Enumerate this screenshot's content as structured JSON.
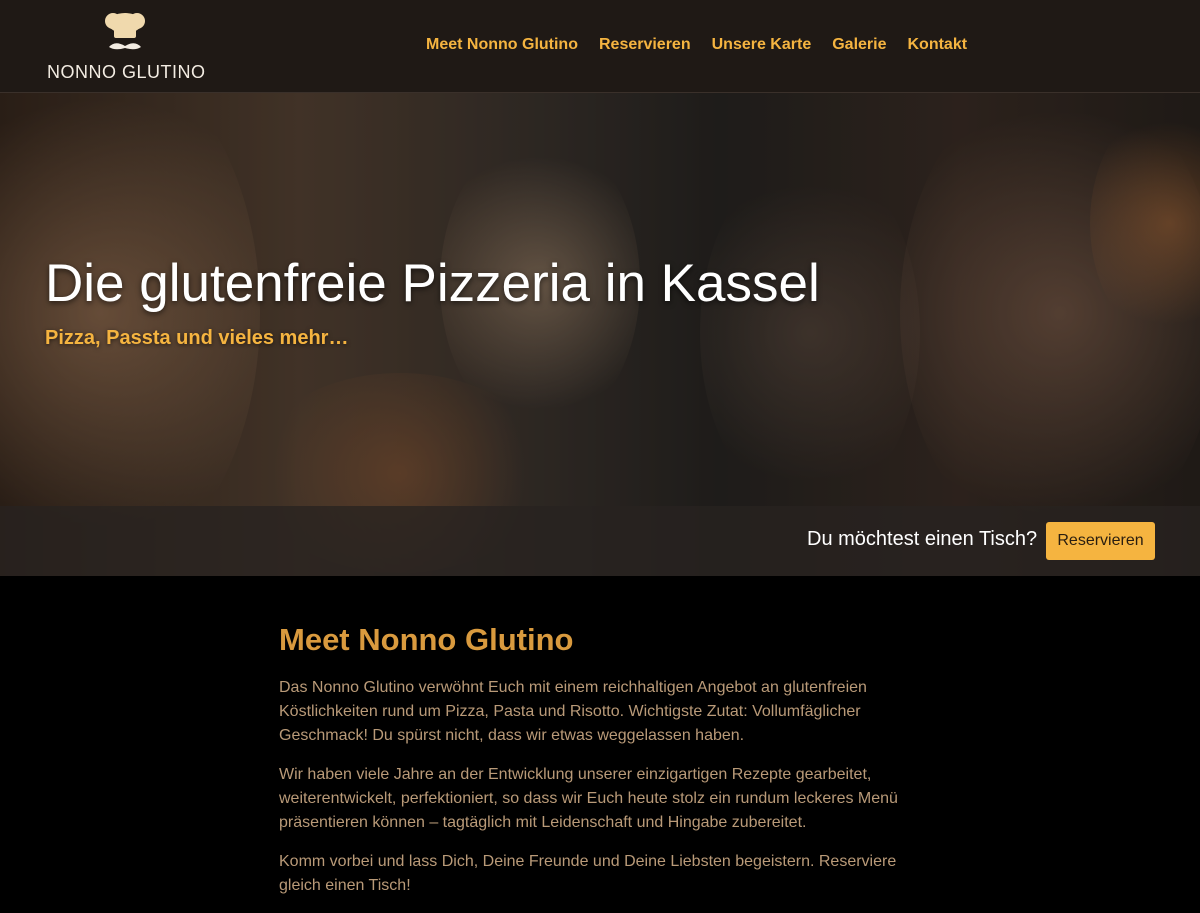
{
  "header": {
    "logo_text": "NONNO GLUTINO",
    "nav": [
      {
        "label": "Meet Nonno Glutino"
      },
      {
        "label": "Reservieren"
      },
      {
        "label": "Unsere Karte"
      },
      {
        "label": "Galerie"
      },
      {
        "label": "Kontakt"
      }
    ]
  },
  "hero": {
    "title": "Die glutenfreie Pizzeria in Kassel",
    "subtitle": "Pizza, Passta und vieles mehr…",
    "cta_text": "Du möchtest einen Tisch?",
    "cta_button": "Reservieren"
  },
  "intro": {
    "heading": "Meet Nonno Glutino",
    "paragraphs": [
      "Das Nonno Glutino verwöhnt Euch mit einem reichhaltigen Angebot an glutenfreien Köstlichkeiten rund um Pizza, Pasta und Risotto. Wichtigste Zutat: Vollumfäglicher Geschmack! Du spürst nicht, dass wir etwas weggelassen haben.",
      "Wir haben viele Jahre an der Entwicklung unserer einzigartigen Rezepte gearbeitet, weiterentwickelt, perfektioniert, so dass wir Euch heute stolz ein rundum leckeres Menü präsentieren können – tagtäglich mit Leidenschaft und Hingabe zubereitet.",
      "Komm vorbei und lass Dich, Deine Freunde und Deine Liebsten begeistern. Reserviere gleich einen Tisch!"
    ]
  },
  "colors": {
    "accent": "#f5b440",
    "heading": "#d99a3e",
    "body_text": "#b99a78",
    "header_bg": "#1f1915",
    "page_bg": "#000000"
  },
  "icons": {
    "logo": "chef-hat-mustache-icon"
  }
}
